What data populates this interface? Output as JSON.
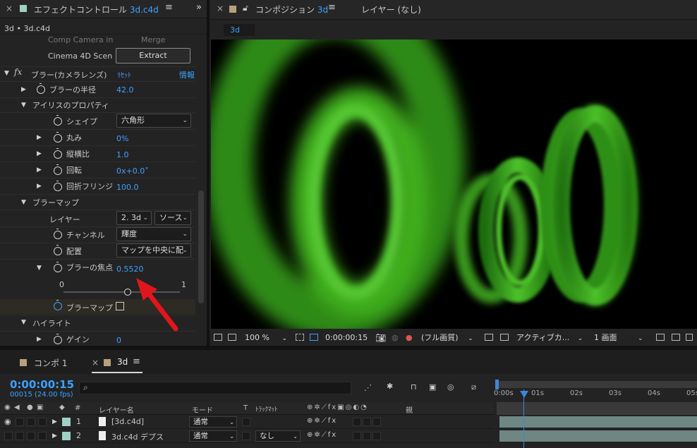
{
  "effect_panel": {
    "tab_prefix": "エフェクトコントロール",
    "tab_file": "3d.c4d",
    "breadcrumb": "3d • 3d.c4d",
    "comp_camera_label": "Comp Camera in",
    "merge_label": "Merge",
    "cinema4d_label": "Cinema 4D Scen",
    "extract_button": "Extract",
    "effect_name": "ブラー(カメラレンズ)",
    "reset_label": "ﾘｾｯﾄ",
    "info_label": "情報",
    "properties": {
      "blur_radius": {
        "label": "ブラーの半径",
        "value": "42.0"
      },
      "iris_group": "アイリスのプロパティ",
      "shape": {
        "label": "シェイプ",
        "value": "六角形"
      },
      "roundness": {
        "label": "丸み",
        "value": "0%"
      },
      "aspect": {
        "label": "縦横比",
        "value": "1.0"
      },
      "rotation": {
        "label": "回転",
        "value": "0x+0.0˚"
      },
      "diffraction": {
        "label": "回折フリンジ",
        "value": "100.0"
      },
      "blur_map_group": "ブラーマップ",
      "layer": {
        "label": "レイヤー",
        "value": "2. 3d",
        "source": "ソース"
      },
      "channel": {
        "label": "チャンネル",
        "value": "輝度"
      },
      "placement": {
        "label": "配置",
        "value": "マップを中央に配"
      },
      "focal": {
        "label": "ブラーの焦点",
        "value": "0.5520",
        "slider_min": "0",
        "slider_max": "1",
        "slider_fraction": 0.552
      },
      "blur_map_invert": {
        "label": "ブラーマップ"
      },
      "highlight_group": "ハイライト",
      "gain": {
        "label": "ゲイン",
        "value": "0"
      }
    }
  },
  "comp_panel": {
    "tab_prefix": "コンポジション",
    "tab_comp": "3d",
    "layer_tab": "レイヤー (なし)",
    "flow_chip": "3d",
    "toolbar": {
      "zoom": "100 %",
      "timecode": "0:00:00:15",
      "resolution": "(フル画質)",
      "camera": "アクティブカ...",
      "views": "1 画面"
    }
  },
  "timeline": {
    "tabs": [
      "コンポ 1",
      "3d"
    ],
    "timecode": "0:00:00:15",
    "frame_info": "00015 (24.00 fps)",
    "search_placeholder": "",
    "ruler": [
      "0:00s",
      "01s",
      "02s",
      "03s",
      "04s",
      "05s"
    ],
    "columns": {
      "num": "#",
      "layer_name": "レイヤー名",
      "mode": "モード",
      "t": "T",
      "trackmatte": "ﾄﾗｯｸﾏｯﾄ",
      "parent": "親"
    },
    "layers": [
      {
        "num": "1",
        "name": "[3d.c4d]",
        "mode": "通常",
        "matte": ""
      },
      {
        "num": "2",
        "name": "3d.c4d デプス",
        "mode": "通常",
        "matte": "なし"
      }
    ]
  },
  "colors": {
    "accent": "#3ea1ff",
    "ring": "#3faa20",
    "arrow": "#e0161c",
    "layer_color": "#9fd0c4"
  }
}
